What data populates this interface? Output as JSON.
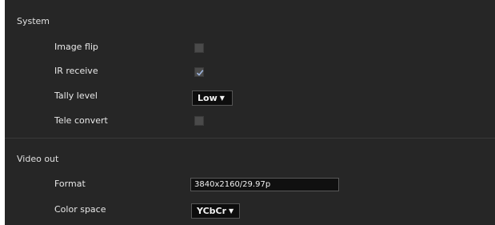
{
  "system": {
    "title": "System",
    "image_flip": {
      "label": "Image flip",
      "checked": false
    },
    "ir_receive": {
      "label": "IR receive",
      "checked": true
    },
    "tally_level": {
      "label": "Tally level",
      "value": "Low"
    },
    "tele_convert": {
      "label": "Tele convert",
      "checked": false
    }
  },
  "video_out": {
    "title": "Video out",
    "format": {
      "label": "Format",
      "value": "3840x2160/29.97p"
    },
    "color_space": {
      "label": "Color space",
      "value": "YCbCr"
    }
  },
  "colors": {
    "panel_bg": "#262626",
    "text": "#e8e8e8",
    "check_mark": "#9fb6e0"
  }
}
